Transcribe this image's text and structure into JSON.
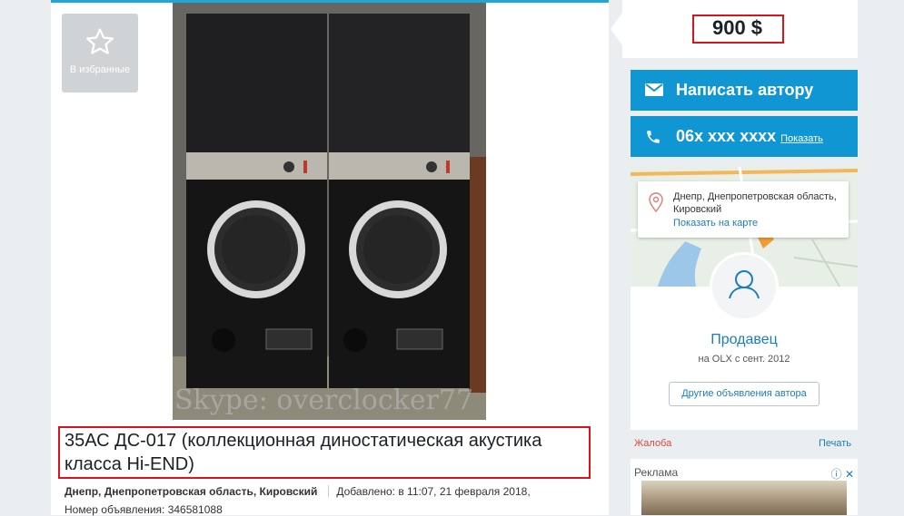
{
  "favorites": {
    "label": "В избранные",
    "icon": "star-icon"
  },
  "photo": {
    "watermark": "Skype: overclocker77"
  },
  "listing": {
    "title": "35АС ДС-017 (коллекционная диностатическая акустика класса Hi-END)",
    "location": "Днепр, Днепропетровская область, Кировский",
    "added": "Добавлено: в 11:07, 21 февраля 2018,",
    "number": "Номер объявления: 346581088"
  },
  "price": "900 $",
  "contact": {
    "message_label": "Написать автору",
    "phone_label": "06х ххх хххх",
    "phone_show": "Показать"
  },
  "location_card": {
    "address": "Днепр, Днепропетровская область, Кировский",
    "show_map": "Показать на карте"
  },
  "seller": {
    "name": "Продавец",
    "since": "на OLX с сент. 2012",
    "other_ads": "Другие объявления автора"
  },
  "actions": {
    "report": "Жалоба",
    "print": "Печать"
  },
  "ad": {
    "label": "Реклама",
    "info_icon": "ⓘ",
    "close_icon": "✕"
  },
  "colors": {
    "accent": "#1196d4",
    "highlight": "#d9121b",
    "link": "#1a7dbf"
  }
}
